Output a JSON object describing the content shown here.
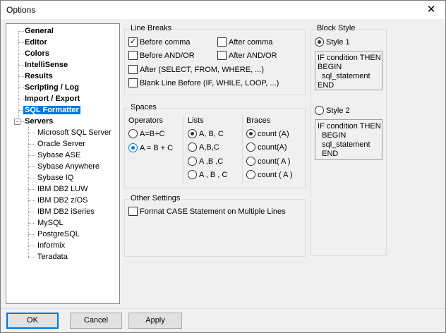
{
  "window": {
    "title": "Options",
    "close_glyph": "✕"
  },
  "tree": {
    "items": [
      {
        "label": "General",
        "bold": true
      },
      {
        "label": "Editor",
        "bold": true
      },
      {
        "label": "Colors",
        "bold": true
      },
      {
        "label": "IntelliSense",
        "bold": true
      },
      {
        "label": "Results",
        "bold": true
      },
      {
        "label": "Scripting / Log",
        "bold": true
      },
      {
        "label": "Import / Export",
        "bold": true
      },
      {
        "label": "SQL Formatter",
        "bold": true,
        "selected": true
      },
      {
        "label": "Servers",
        "bold": true,
        "expanded": true
      }
    ],
    "servers": [
      "Microsoft SQL Server",
      "Oracle Server",
      "Sybase ASE",
      "Sybase Anywhere",
      "Sybase IQ",
      "IBM DB2 LUW",
      "IBM DB2 z/OS",
      "IBM DB2 iSeries",
      "MySQL",
      "PostgreSQL",
      "Informix",
      "Teradata"
    ],
    "expander_glyph": "−"
  },
  "line_breaks": {
    "title": "Line Breaks",
    "before_comma": {
      "label": "Before comma",
      "checked": true
    },
    "after_comma": {
      "label": "After comma",
      "checked": false
    },
    "before_andor": {
      "label": "Before AND/OR",
      "checked": false
    },
    "after_andor": {
      "label": "After AND/OR",
      "checked": false
    },
    "after": {
      "label": "After  (SELECT, FROM, WHERE, ...)",
      "checked": false
    },
    "blank_line": {
      "label": "Blank Line Before (IF, WHILE, LOOP, ...)",
      "checked": false
    },
    "check_glyph": "✓"
  },
  "spaces": {
    "title": "Spaces",
    "operators": {
      "title": "Operators",
      "options": [
        "A=B+C",
        "A = B + C"
      ],
      "selected": 1
    },
    "lists": {
      "title": "Lists",
      "options": [
        "A, B, C",
        "A,B,C",
        "A ,B ,C",
        "A , B , C"
      ],
      "selected": 0
    },
    "braces": {
      "title": "Braces",
      "options": [
        "count (A)",
        "count(A)",
        "count( A )",
        "count ( A )"
      ],
      "selected": 0
    }
  },
  "other_settings": {
    "title": "Other Settings",
    "format_case": {
      "label": "Format CASE Statement on Multiple Lines",
      "checked": false
    }
  },
  "block_style": {
    "title": "Block Style",
    "style1": {
      "label": "Style 1",
      "selected": true,
      "preview": [
        "IF condition THEN",
        "BEGIN",
        "  sql_statement",
        "END"
      ]
    },
    "style2": {
      "label": "Style 2",
      "selected": false,
      "preview": [
        "IF condition THEN",
        "  BEGIN",
        "  sql_statement",
        "  END"
      ]
    }
  },
  "buttons": {
    "ok": "OK",
    "cancel": "Cancel",
    "apply": "Apply"
  },
  "colors": {
    "accent": "#0078d7",
    "selection": "#0078d7"
  }
}
